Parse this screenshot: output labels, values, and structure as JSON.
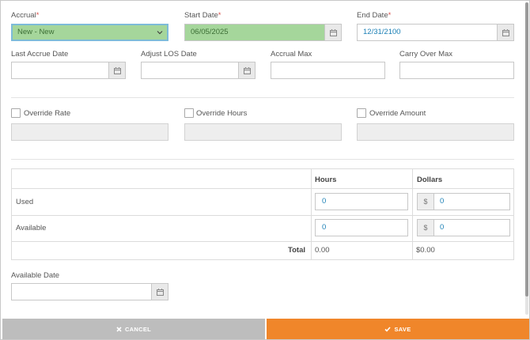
{
  "accrual": {
    "label": "Accrual",
    "required_mark": "*",
    "value": "New - New"
  },
  "start_date": {
    "label": "Start Date",
    "required_mark": "*",
    "value": "06/05/2025"
  },
  "end_date": {
    "label": "End Date",
    "required_mark": "*",
    "value": "12/31/2100"
  },
  "last_accrue_date": {
    "label": "Last Accrue Date",
    "value": ""
  },
  "adjust_los_date": {
    "label": "Adjust LOS Date",
    "value": ""
  },
  "accrual_max": {
    "label": "Accrual Max",
    "value": ""
  },
  "carry_over_max": {
    "label": "Carry Over Max",
    "value": ""
  },
  "overrides": {
    "rate": {
      "label": "Override Rate",
      "value": ""
    },
    "hours": {
      "label": "Override Hours",
      "value": ""
    },
    "amount": {
      "label": "Override Amount",
      "value": ""
    }
  },
  "balance_table": {
    "headers": {
      "hours": "Hours",
      "dollars": "Dollars"
    },
    "currency_symbol": "$",
    "rows": [
      {
        "label": "Used",
        "hours": "0",
        "dollars": "0"
      },
      {
        "label": "Available",
        "hours": "0",
        "dollars": "0"
      }
    ],
    "total": {
      "label": "Total",
      "hours": "0.00",
      "dollars": "$0.00"
    }
  },
  "available_date": {
    "label": "Available Date",
    "value": ""
  },
  "buttons": {
    "cancel": "CANCEL",
    "save": "SAVE"
  },
  "icons": {
    "calendar": "calendar-icon",
    "dropdown": "chevron-down-icon",
    "cancel": "x-icon",
    "save": "check-icon"
  },
  "colors": {
    "required": "#d9534f",
    "value_text": "#1a7fb5",
    "accrual_bg": "#a5d69b",
    "save_bg": "#f0862a",
    "cancel_bg": "#bdbdbd"
  }
}
